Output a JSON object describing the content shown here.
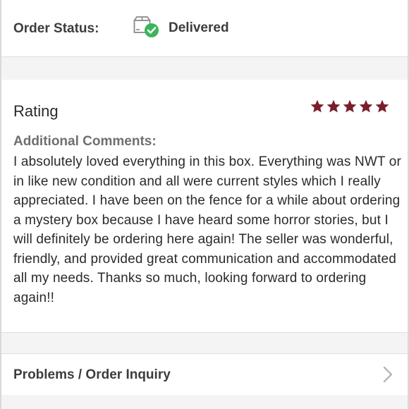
{
  "order_status": {
    "label": "Order Status:",
    "value": "Delivered",
    "icon": "package-delivered-check-icon",
    "status_color": "#3cb55a"
  },
  "rating": {
    "title": "Rating",
    "stars": 5,
    "max_stars": 5,
    "star_color": "#7b1e2a"
  },
  "comments": {
    "label": "Additional Comments:",
    "text": "I absolutely loved everything in this box. Everything was NWT or in like new condition and all were current styles which I really appreciated. I have been on the fence for a while about ordering a mystery box because I have heard some horror stories, but I will definitely be ordering here again! The seller was wonderful, friendly, and provided great communication and accommodated all my needs. Thanks so much, looking forward to ordering again!!"
  },
  "problems": {
    "label": "Problems / Order Inquiry",
    "icon": "chevron-right-icon"
  }
}
